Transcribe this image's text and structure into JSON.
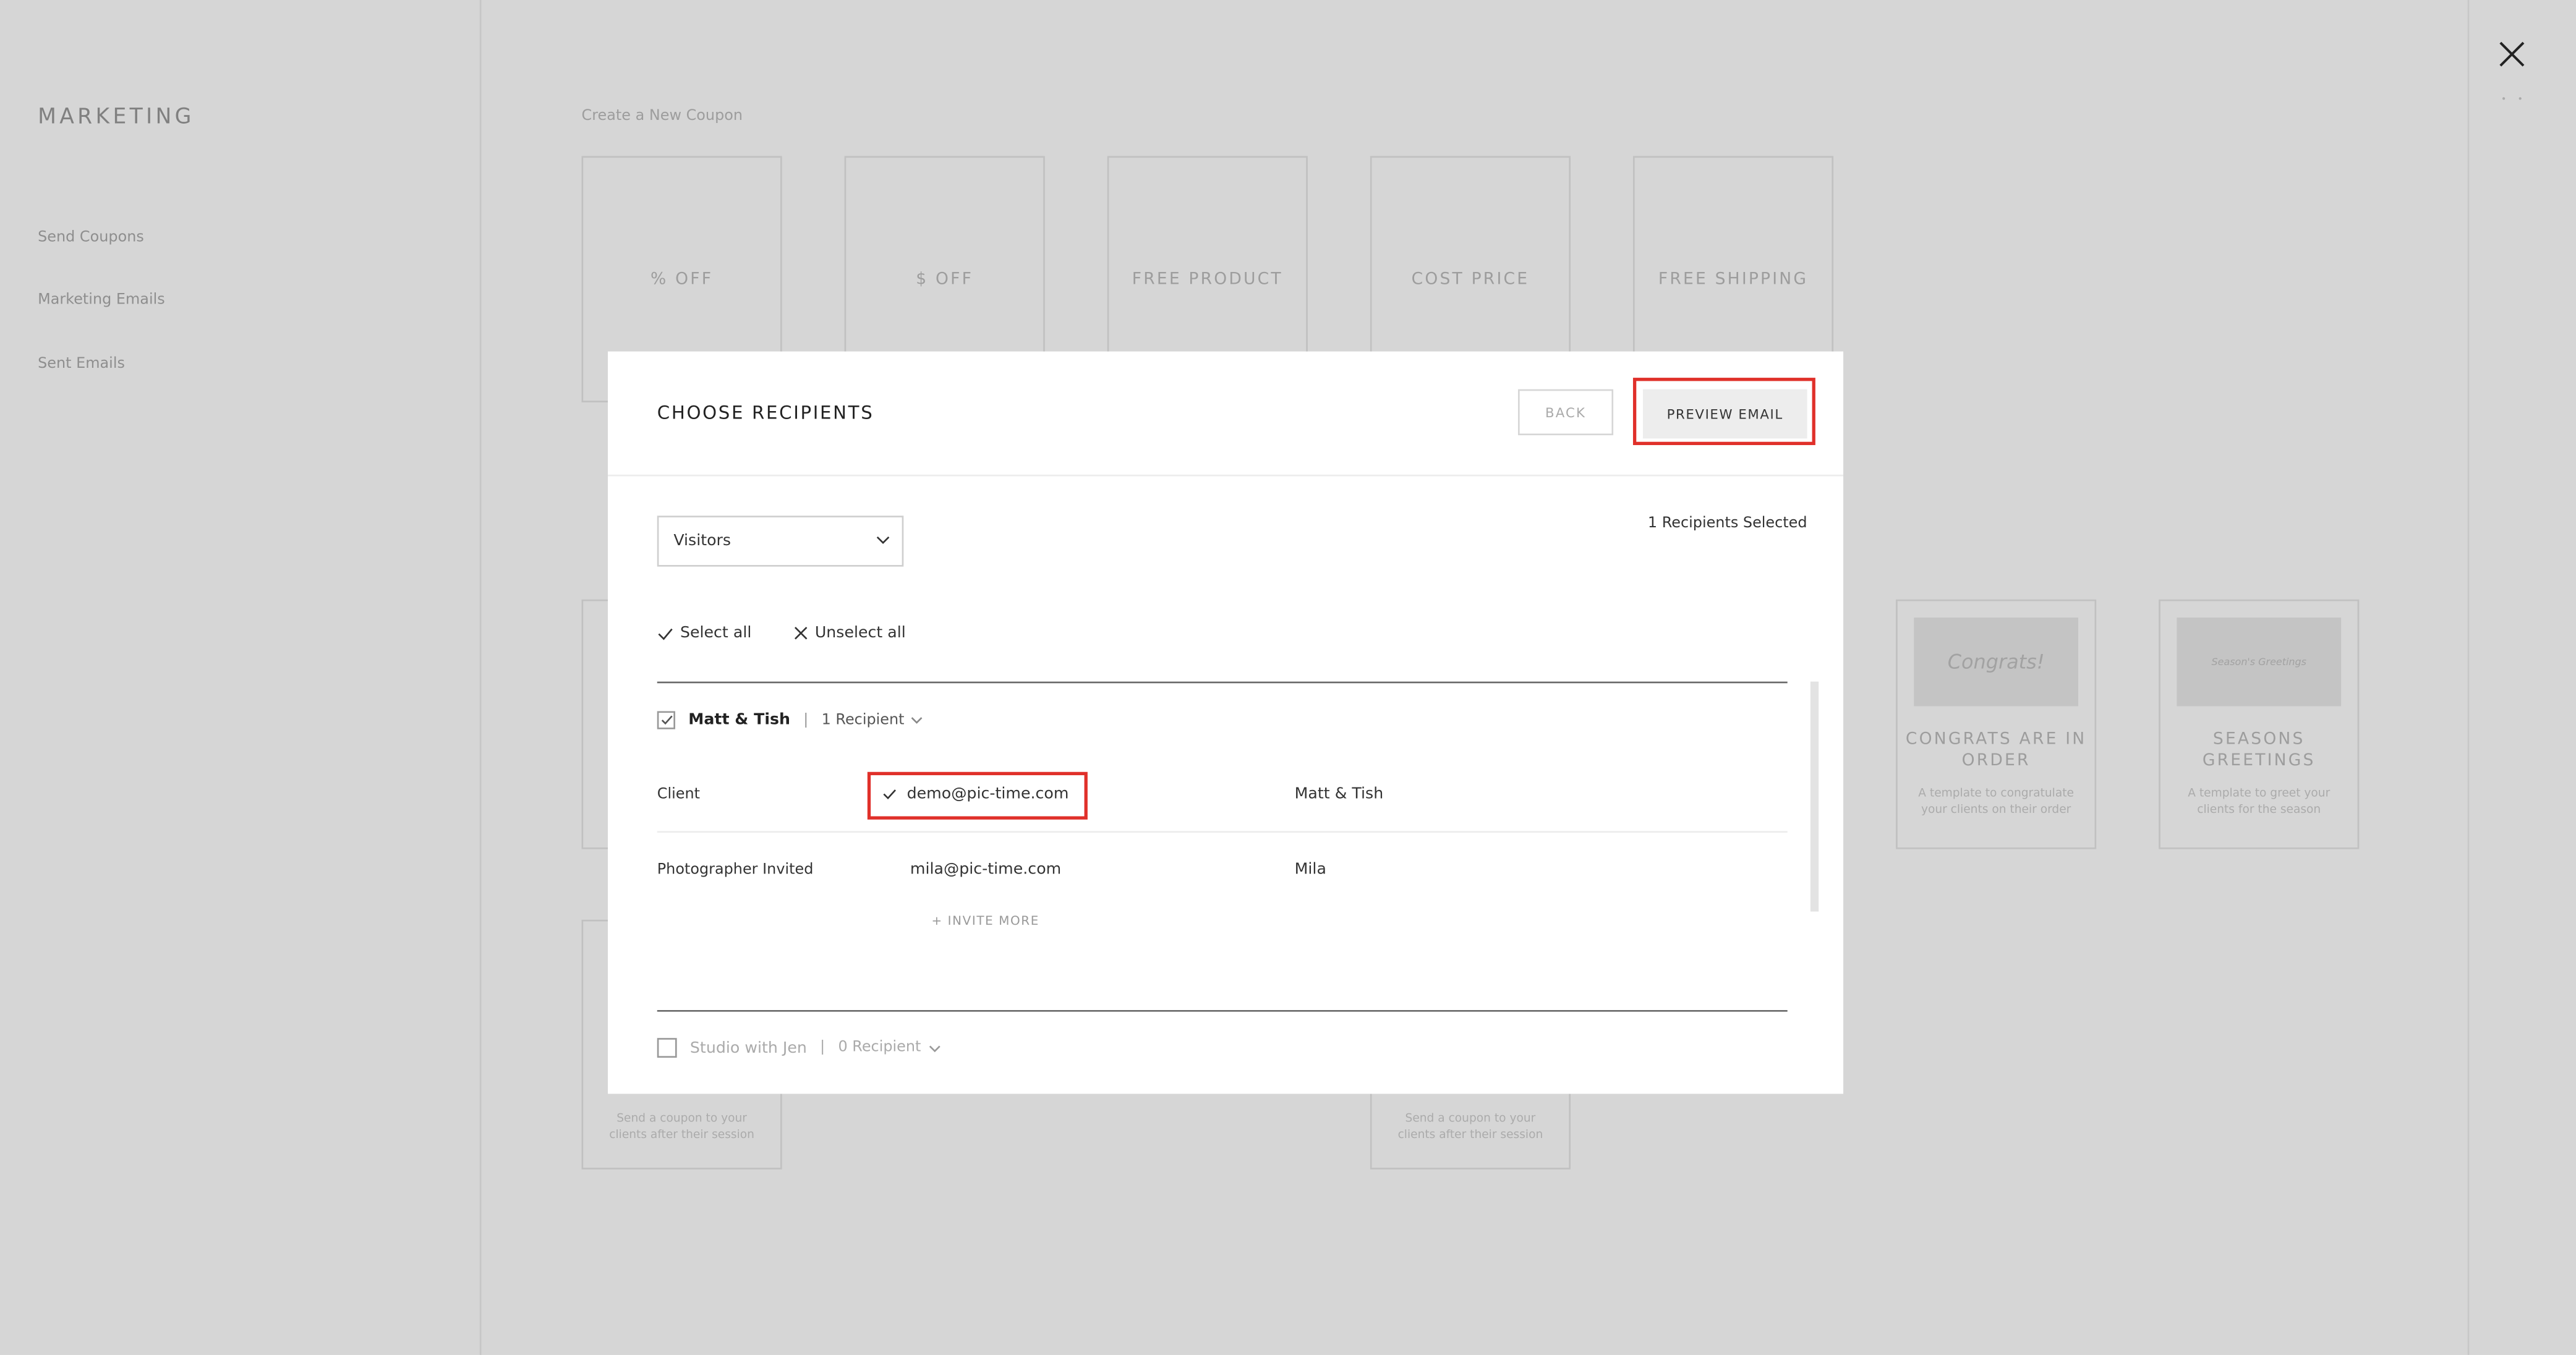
{
  "sidebar": {
    "title": "MARKETING",
    "links": [
      "Send Coupons",
      "Marketing Emails",
      "Sent Emails"
    ]
  },
  "background": {
    "section_heading": "Create a New Coupon",
    "coupon_types": [
      "% OFF",
      "$ OFF",
      "FREE PRODUCT",
      "COST PRICE",
      "FREE SHIPPING"
    ],
    "email_template_cards": [
      {
        "thumb": "Congrats!",
        "title": "CONGRATS ARE IN ORDER",
        "desc": "A template to congratulate your clients on their order"
      },
      {
        "thumb": "Season's Greetings",
        "title": "SEASONS GREETINGS",
        "desc": "A template to greet your clients for the season"
      }
    ],
    "bottom_texts": [
      "Send a coupon to your clients after their session",
      "Send a coupon to your clients after their session"
    ]
  },
  "modal": {
    "title": "CHOOSE RECIPIENTS",
    "back_label": "BACK",
    "preview_label": "PREVIEW EMAIL",
    "recipients_selected": "1 Recipients Selected",
    "filter": {
      "selected": "Visitors"
    },
    "select_all_label": "Select all",
    "unselect_all_label": "Unselect all",
    "groups": [
      {
        "name": "Matt & Tish",
        "count_label": "1 Recipient",
        "checked": true,
        "recipients": [
          {
            "role": "Client",
            "email": "demo@pic-time.com",
            "name": "Matt & Tish",
            "checked": true
          },
          {
            "role": "Photographer Invited",
            "email": "mila@pic-time.com",
            "name": "Mila",
            "checked": false
          }
        ],
        "invite_more_label": "+ INVITE MORE"
      },
      {
        "name": "Studio with Jen",
        "count_label": "0 Recipient",
        "checked": false
      }
    ]
  },
  "colors": {
    "highlight": "#e0302a",
    "overlay": "rgba(0,0,0,0.16)"
  }
}
